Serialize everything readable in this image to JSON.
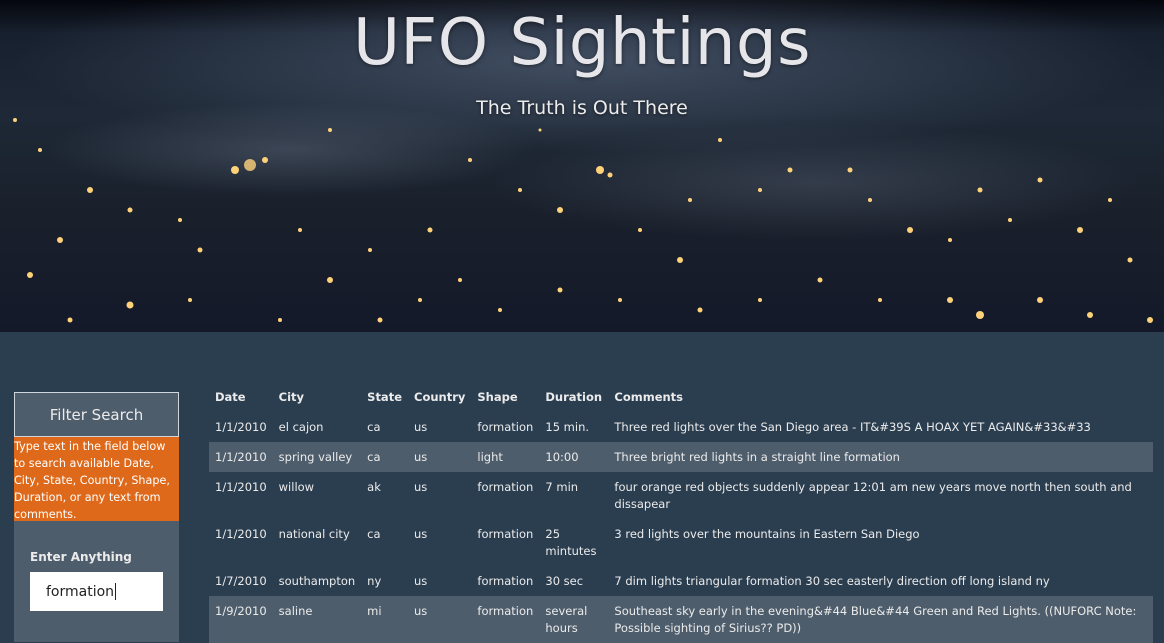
{
  "header": {
    "title": "UFO Sightings",
    "subtitle": "The Truth is Out There"
  },
  "sidebar": {
    "heading": "Filter Search",
    "help_text": "Type text in the field below to search available Date, City, State, Country, Shape, Duration, or any text from comments.",
    "input_label": "Enter Anything",
    "input_value": "formation"
  },
  "table": {
    "headers": [
      "Date",
      "City",
      "State",
      "Country",
      "Shape",
      "Duration",
      "Comments"
    ],
    "rows": [
      {
        "date": "1/1/2010",
        "city": "el cajon",
        "state": "ca",
        "country": "us",
        "shape": "formation",
        "duration": "15 min.",
        "comments": "Three red lights over the San Diego area - IT&#39S A HOAX YET AGAIN&#33&#33"
      },
      {
        "date": "1/1/2010",
        "city": "spring valley",
        "state": "ca",
        "country": "us",
        "shape": "light",
        "duration": "10:00",
        "comments": "Three bright red lights in a straight line formation"
      },
      {
        "date": "1/1/2010",
        "city": "willow",
        "state": "ak",
        "country": "us",
        "shape": "formation",
        "duration": "7 min",
        "comments": "four orange red objects suddenly appear 12:01 am new years move north then south and dissapear"
      },
      {
        "date": "1/1/2010",
        "city": "national city",
        "state": "ca",
        "country": "us",
        "shape": "formation",
        "duration": "25 mintutes",
        "comments": "3 red lights over the mountains in Eastern San Diego"
      },
      {
        "date": "1/7/2010",
        "city": "southampton",
        "state": "ny",
        "country": "us",
        "shape": "formation",
        "duration": "30 sec",
        "comments": "7 dim lights triangular formation 30 sec easterly direction off long island ny"
      },
      {
        "date": "1/9/2010",
        "city": "saline",
        "state": "mi",
        "country": "us",
        "shape": "formation",
        "duration": "several hours",
        "comments": "Southeast sky early in the evening&#44 Blue&#44 Green and Red Lights. ((NUFORC Note: Possible sighting of Sirius?? PD))"
      }
    ]
  },
  "colors": {
    "page_bg": "#2b3e50",
    "panel_bg": "#4e5d6c",
    "accent_orange": "#df691a"
  }
}
